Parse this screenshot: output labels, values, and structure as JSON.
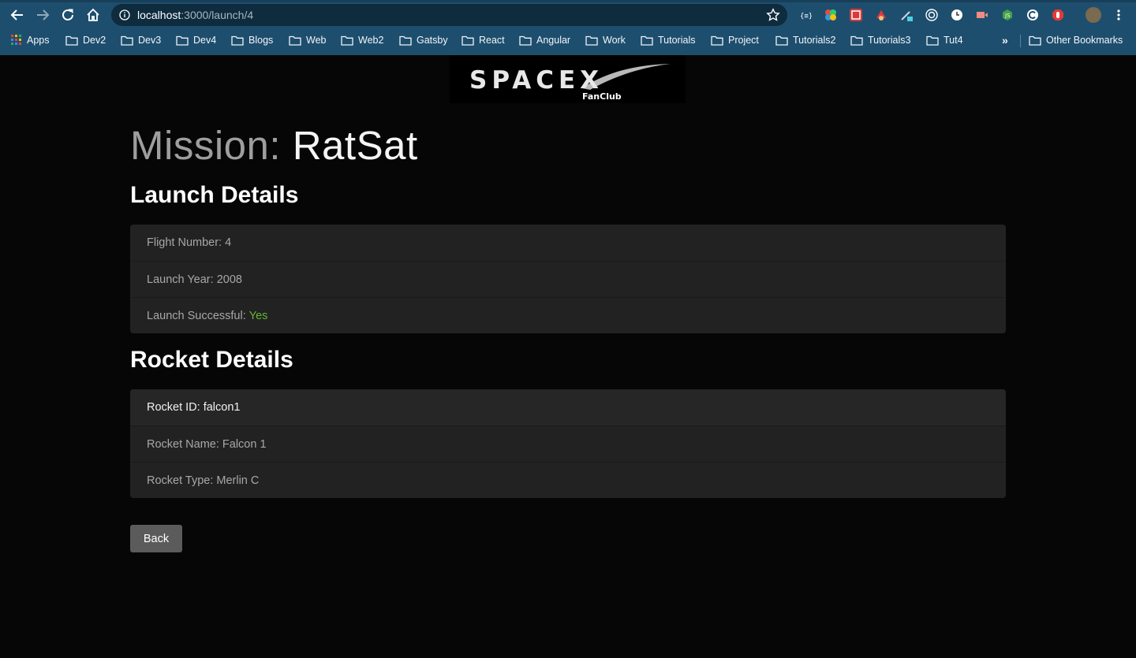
{
  "browser": {
    "url_host": "localhost",
    "url_rest": ":3000/launch/4",
    "bookmarks": [
      "Apps",
      "Dev2",
      "Dev3",
      "Dev4",
      "Blogs",
      "Web",
      "Web2",
      "Gatsby",
      "React",
      "Angular",
      "Work",
      "Tutorials",
      "Project",
      "Tutorials2",
      "Tutorials3",
      "Tut4"
    ],
    "overflow_label": "»",
    "other_bookmarks": "Other Bookmarks"
  },
  "logo": {
    "brand": "SPACEX",
    "sub": "FanClub"
  },
  "mission": {
    "label": "Mission:",
    "name": "RatSat"
  },
  "launch_details": {
    "heading": "Launch Details",
    "flight_number_label": "Flight Number:",
    "flight_number": "4",
    "launch_year_label": "Launch Year:",
    "launch_year": "2008",
    "launch_success_label": "Launch Successful:",
    "launch_success": "Yes",
    "success_color": "#62b534"
  },
  "rocket_details": {
    "heading": "Rocket Details",
    "rocket_id_label": "Rocket ID:",
    "rocket_id": "falcon1",
    "rocket_name_label": "Rocket Name:",
    "rocket_name": "Falcon 1",
    "rocket_type_label": "Rocket Type:",
    "rocket_type": "Merlin C"
  },
  "back_button": "Back"
}
